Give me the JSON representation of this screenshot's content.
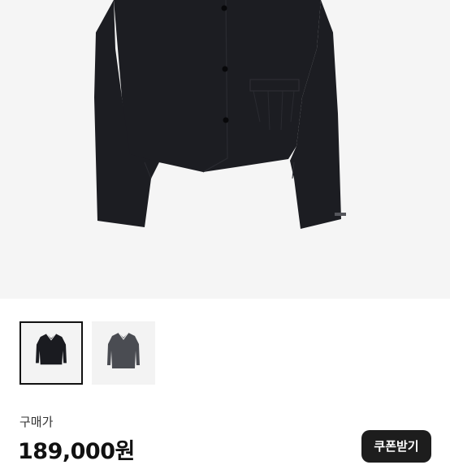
{
  "product": {
    "jacket_color": "#1c1d22",
    "thumbnails": [
      {
        "name": "black",
        "color": "#1a1b20",
        "selected": true
      },
      {
        "name": "charcoal",
        "color": "#4a4c52",
        "selected": false
      }
    ]
  },
  "price": {
    "label": "구매가",
    "value": "189,000원"
  },
  "coupon": {
    "label": "쿠폰받기"
  }
}
